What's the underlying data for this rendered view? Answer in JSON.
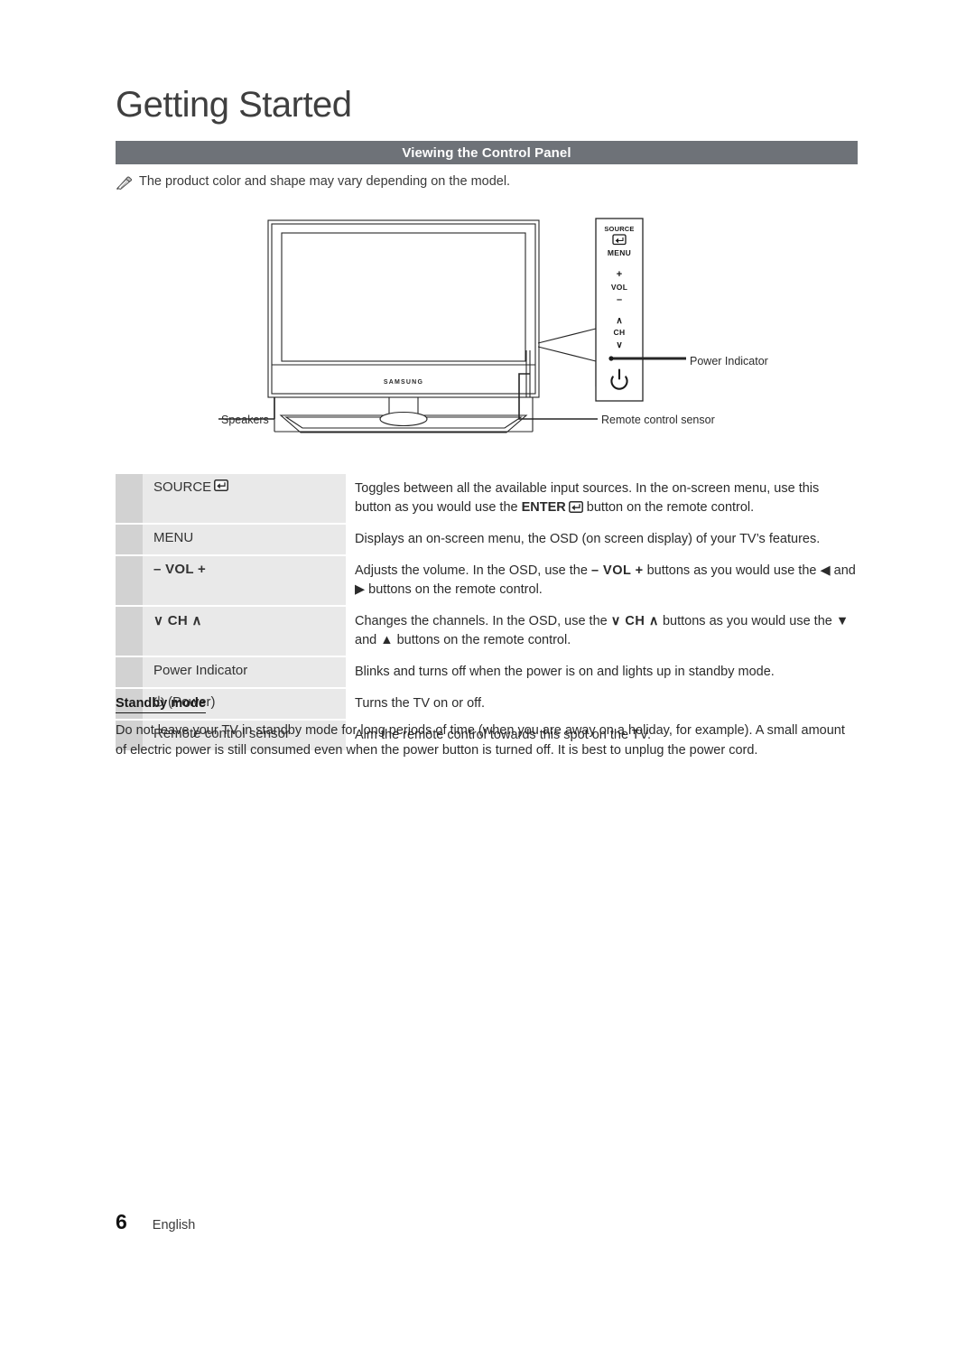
{
  "chapter": {
    "title": "Getting Started"
  },
  "section": {
    "heading": "Viewing the Control Panel"
  },
  "note": {
    "icon": "note-pencil-icon",
    "text": "The product color and shape may vary depending on the model."
  },
  "figure": {
    "brand_logo": "SAMSUNG",
    "panel_buttons": [
      {
        "line1": "SOURCE",
        "glyph": "enter-icon"
      },
      {
        "line1": "MENU"
      },
      {
        "line1": "+",
        "line2": "VOL",
        "line3": "–"
      },
      {
        "line1": "∧",
        "line2": "CH",
        "line3": "∨"
      },
      {
        "line1": "power-dot-indicator"
      },
      {
        "line1": "power-icon"
      }
    ],
    "callouts": {
      "power_indicator": "Power Indicator",
      "remote_sensor": "Remote control sensor",
      "speakers": "Speakers"
    }
  },
  "spec_table": {
    "rows": [
      {
        "key_text": "SOURCE",
        "key_style": "plain",
        "key_icon": "enter-icon",
        "desc_parts": [
          {
            "t": "Toggles between all the available input sources. In the on-screen menu, use this button as you would use the "
          },
          {
            "t": "ENTER",
            "b": true
          },
          {
            "icon": "enter-icon"
          },
          {
            "t": " button on the remote control."
          }
        ]
      },
      {
        "key_text": "MENU",
        "key_style": "plain",
        "desc_parts": [
          {
            "t": "Displays an on-screen menu, the OSD (on screen display) of your TV’s features."
          }
        ]
      },
      {
        "key_text": "– VOL +",
        "key_style": "bold",
        "desc_parts": [
          {
            "t": "Adjusts the volume. In the OSD, use the "
          },
          {
            "t": "– VOL +",
            "b": true
          },
          {
            "t": " buttons as you would use the ◀ and ▶ buttons on the remote control."
          }
        ]
      },
      {
        "key_text": "∨ CH ∧",
        "key_style": "bold",
        "desc_parts": [
          {
            "t": "Changes the channels. In the OSD, use the "
          },
          {
            "t": "∨ CH ∧",
            "b": true
          },
          {
            "t": " buttons as you would use the ▼ and ▲ buttons on the remote control."
          }
        ]
      },
      {
        "key_text": "Power Indicator",
        "key_style": "plain",
        "desc_parts": [
          {
            "t": "Blinks and turns off when the power is on and lights up in standby mode."
          }
        ]
      },
      {
        "key_text": "⏻ (Power)",
        "key_style": "plain",
        "desc_parts": [
          {
            "t": "Turns the TV on or off."
          }
        ]
      },
      {
        "key_text": "Remote control sensor",
        "key_style": "plain",
        "desc_parts": [
          {
            "t": "Aim the remote control towards this spot on the TV."
          }
        ]
      }
    ]
  },
  "standby": {
    "heading": "Standby mode",
    "body": "Do not leave your TV in standby mode for long periods of time (when you are away on a holiday, for example). A small amount of electric power is still consumed even when the power button is turned off. It is best to unplug the power cord."
  },
  "footer": {
    "page_number": "6",
    "language": "English"
  },
  "colors": {
    "section_bar": "#6e7278",
    "swatch": "#d2d2d2",
    "key_cell": "#e9e9e9",
    "text": "#2b2b2b"
  }
}
